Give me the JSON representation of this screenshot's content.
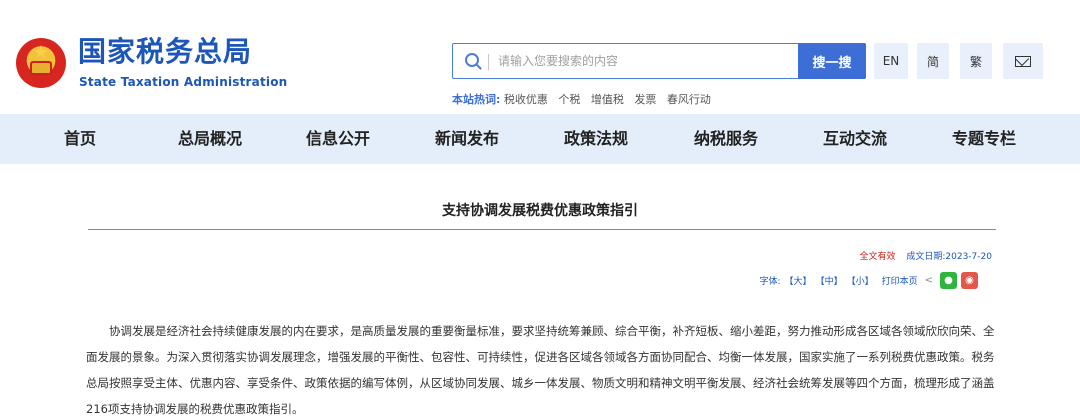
{
  "header": {
    "brand_cn": "国家税务总局",
    "brand_en": "State Taxation Administration",
    "search": {
      "placeholder": "请输入您要搜索的内容",
      "button": "搜一搜"
    },
    "buttons": {
      "en": "EN",
      "simplified": "简",
      "traditional": "繁"
    },
    "hot_label": "本站热词:",
    "hot_words": [
      "税收优惠",
      "个税",
      "增值税",
      "发票",
      "春风行动"
    ]
  },
  "nav": {
    "items": [
      "首页",
      "总局概况",
      "信息公开",
      "新闻发布",
      "政策法规",
      "纳税服务",
      "互动交流",
      "专题专栏"
    ]
  },
  "article": {
    "title": "支持协调发展税费优惠政策指引",
    "validity": "全文有效",
    "date": "成文日期:2023-7-20",
    "font_label": "字体:",
    "font_large": "【大】",
    "font_medium": "【中】",
    "font_small": "【小】",
    "print": "打印本页",
    "paragraph": "协调发展是经济社会持续健康发展的内在要求，是高质量发展的重要衡量标准，要求坚持统筹兼顾、综合平衡，补齐短板、缩小差距，努力推动形成各区域各领域欣欣向荣、全面发展的景象。为深入贯彻落实协调发展理念，增强发展的平衡性、包容性、可持续性，促进各区域各领域各方面协同配合、均衡一体发展，国家实施了一系列税费优惠政策。税务总局按照享受主体、优惠内容、享受条件、政策依据的编写体例，从区域协同发展、城乡一体发展、物质文明和精神文明平衡发展、经济社会统筹发展等四个方面，梳理形成了涵盖216项支持协调发展的税费优惠政策指引。"
  },
  "colors": {
    "brand_blue": "#1b56b8",
    "search_button": "#3d6ed6",
    "nav_bg": "#e4eefb",
    "red": "#d0201a"
  }
}
